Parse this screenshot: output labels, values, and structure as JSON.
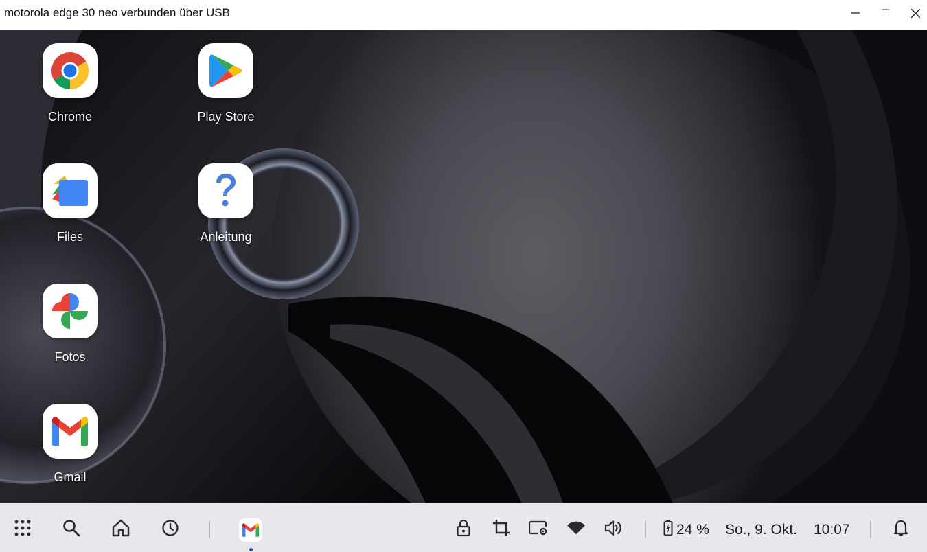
{
  "window": {
    "title": "motorola edge 30 neo verbunden über USB",
    "controls": [
      "minimize-icon",
      "maximize-icon",
      "close-icon"
    ]
  },
  "desktop": {
    "apps": [
      {
        "label": "Chrome",
        "icon": "chrome-icon"
      },
      {
        "label": "Play Store",
        "icon": "play-store-icon"
      },
      {
        "label": "Files",
        "icon": "files-icon"
      },
      {
        "label": "Anleitung",
        "icon": "help-icon"
      },
      {
        "label": "Fotos",
        "icon": "photos-icon"
      },
      {
        "label": "Gmail",
        "icon": "gmail-icon"
      }
    ]
  },
  "taskbar": {
    "left_icons": [
      "app-drawer-icon",
      "search-icon",
      "home-icon",
      "recents-icon"
    ],
    "pinned_apps": [
      {
        "name": "Gmail",
        "icon": "gmail-icon",
        "running": true
      }
    ],
    "quick_icons": [
      "lock-icon",
      "crop-icon",
      "screen-settings-icon",
      "wifi-icon",
      "volume-icon"
    ],
    "battery": "24 %",
    "date": "So., 9. Okt.",
    "time": "10:07",
    "notification_icon": "bell-icon"
  },
  "colors": {
    "taskbar_bg": "#e9e7ed",
    "titlebar_bg": "#ffffff",
    "accent_dot": "#1b4fa0"
  }
}
